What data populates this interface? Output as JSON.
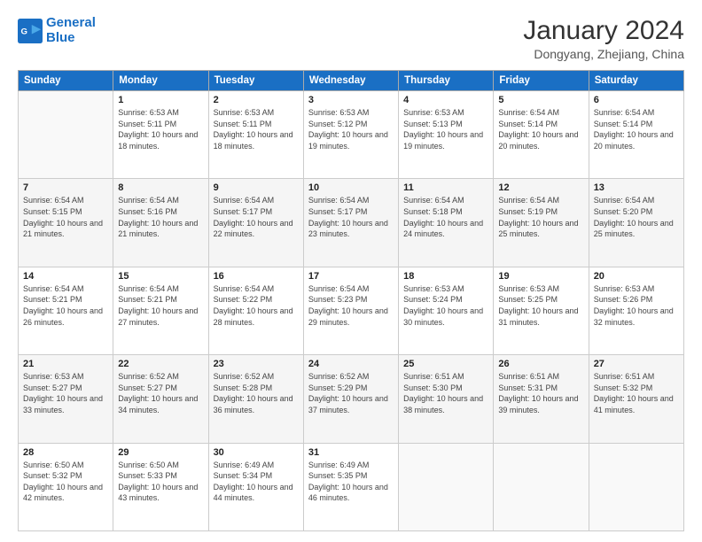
{
  "header": {
    "logo_line1": "General",
    "logo_line2": "Blue",
    "month_year": "January 2024",
    "location": "Dongyang, Zhejiang, China"
  },
  "days_of_week": [
    "Sunday",
    "Monday",
    "Tuesday",
    "Wednesday",
    "Thursday",
    "Friday",
    "Saturday"
  ],
  "weeks": [
    [
      {
        "day": "",
        "sunrise": "",
        "sunset": "",
        "daylight": ""
      },
      {
        "day": "1",
        "sunrise": "Sunrise: 6:53 AM",
        "sunset": "Sunset: 5:11 PM",
        "daylight": "Daylight: 10 hours and 18 minutes."
      },
      {
        "day": "2",
        "sunrise": "Sunrise: 6:53 AM",
        "sunset": "Sunset: 5:11 PM",
        "daylight": "Daylight: 10 hours and 18 minutes."
      },
      {
        "day": "3",
        "sunrise": "Sunrise: 6:53 AM",
        "sunset": "Sunset: 5:12 PM",
        "daylight": "Daylight: 10 hours and 19 minutes."
      },
      {
        "day": "4",
        "sunrise": "Sunrise: 6:53 AM",
        "sunset": "Sunset: 5:13 PM",
        "daylight": "Daylight: 10 hours and 19 minutes."
      },
      {
        "day": "5",
        "sunrise": "Sunrise: 6:54 AM",
        "sunset": "Sunset: 5:14 PM",
        "daylight": "Daylight: 10 hours and 20 minutes."
      },
      {
        "day": "6",
        "sunrise": "Sunrise: 6:54 AM",
        "sunset": "Sunset: 5:14 PM",
        "daylight": "Daylight: 10 hours and 20 minutes."
      }
    ],
    [
      {
        "day": "7",
        "sunrise": "Sunrise: 6:54 AM",
        "sunset": "Sunset: 5:15 PM",
        "daylight": "Daylight: 10 hours and 21 minutes."
      },
      {
        "day": "8",
        "sunrise": "Sunrise: 6:54 AM",
        "sunset": "Sunset: 5:16 PM",
        "daylight": "Daylight: 10 hours and 21 minutes."
      },
      {
        "day": "9",
        "sunrise": "Sunrise: 6:54 AM",
        "sunset": "Sunset: 5:17 PM",
        "daylight": "Daylight: 10 hours and 22 minutes."
      },
      {
        "day": "10",
        "sunrise": "Sunrise: 6:54 AM",
        "sunset": "Sunset: 5:17 PM",
        "daylight": "Daylight: 10 hours and 23 minutes."
      },
      {
        "day": "11",
        "sunrise": "Sunrise: 6:54 AM",
        "sunset": "Sunset: 5:18 PM",
        "daylight": "Daylight: 10 hours and 24 minutes."
      },
      {
        "day": "12",
        "sunrise": "Sunrise: 6:54 AM",
        "sunset": "Sunset: 5:19 PM",
        "daylight": "Daylight: 10 hours and 25 minutes."
      },
      {
        "day": "13",
        "sunrise": "Sunrise: 6:54 AM",
        "sunset": "Sunset: 5:20 PM",
        "daylight": "Daylight: 10 hours and 25 minutes."
      }
    ],
    [
      {
        "day": "14",
        "sunrise": "Sunrise: 6:54 AM",
        "sunset": "Sunset: 5:21 PM",
        "daylight": "Daylight: 10 hours and 26 minutes."
      },
      {
        "day": "15",
        "sunrise": "Sunrise: 6:54 AM",
        "sunset": "Sunset: 5:21 PM",
        "daylight": "Daylight: 10 hours and 27 minutes."
      },
      {
        "day": "16",
        "sunrise": "Sunrise: 6:54 AM",
        "sunset": "Sunset: 5:22 PM",
        "daylight": "Daylight: 10 hours and 28 minutes."
      },
      {
        "day": "17",
        "sunrise": "Sunrise: 6:54 AM",
        "sunset": "Sunset: 5:23 PM",
        "daylight": "Daylight: 10 hours and 29 minutes."
      },
      {
        "day": "18",
        "sunrise": "Sunrise: 6:53 AM",
        "sunset": "Sunset: 5:24 PM",
        "daylight": "Daylight: 10 hours and 30 minutes."
      },
      {
        "day": "19",
        "sunrise": "Sunrise: 6:53 AM",
        "sunset": "Sunset: 5:25 PM",
        "daylight": "Daylight: 10 hours and 31 minutes."
      },
      {
        "day": "20",
        "sunrise": "Sunrise: 6:53 AM",
        "sunset": "Sunset: 5:26 PM",
        "daylight": "Daylight: 10 hours and 32 minutes."
      }
    ],
    [
      {
        "day": "21",
        "sunrise": "Sunrise: 6:53 AM",
        "sunset": "Sunset: 5:27 PM",
        "daylight": "Daylight: 10 hours and 33 minutes."
      },
      {
        "day": "22",
        "sunrise": "Sunrise: 6:52 AM",
        "sunset": "Sunset: 5:27 PM",
        "daylight": "Daylight: 10 hours and 34 minutes."
      },
      {
        "day": "23",
        "sunrise": "Sunrise: 6:52 AM",
        "sunset": "Sunset: 5:28 PM",
        "daylight": "Daylight: 10 hours and 36 minutes."
      },
      {
        "day": "24",
        "sunrise": "Sunrise: 6:52 AM",
        "sunset": "Sunset: 5:29 PM",
        "daylight": "Daylight: 10 hours and 37 minutes."
      },
      {
        "day": "25",
        "sunrise": "Sunrise: 6:51 AM",
        "sunset": "Sunset: 5:30 PM",
        "daylight": "Daylight: 10 hours and 38 minutes."
      },
      {
        "day": "26",
        "sunrise": "Sunrise: 6:51 AM",
        "sunset": "Sunset: 5:31 PM",
        "daylight": "Daylight: 10 hours and 39 minutes."
      },
      {
        "day": "27",
        "sunrise": "Sunrise: 6:51 AM",
        "sunset": "Sunset: 5:32 PM",
        "daylight": "Daylight: 10 hours and 41 minutes."
      }
    ],
    [
      {
        "day": "28",
        "sunrise": "Sunrise: 6:50 AM",
        "sunset": "Sunset: 5:32 PM",
        "daylight": "Daylight: 10 hours and 42 minutes."
      },
      {
        "day": "29",
        "sunrise": "Sunrise: 6:50 AM",
        "sunset": "Sunset: 5:33 PM",
        "daylight": "Daylight: 10 hours and 43 minutes."
      },
      {
        "day": "30",
        "sunrise": "Sunrise: 6:49 AM",
        "sunset": "Sunset: 5:34 PM",
        "daylight": "Daylight: 10 hours and 44 minutes."
      },
      {
        "day": "31",
        "sunrise": "Sunrise: 6:49 AM",
        "sunset": "Sunset: 5:35 PM",
        "daylight": "Daylight: 10 hours and 46 minutes."
      },
      {
        "day": "",
        "sunrise": "",
        "sunset": "",
        "daylight": ""
      },
      {
        "day": "",
        "sunrise": "",
        "sunset": "",
        "daylight": ""
      },
      {
        "day": "",
        "sunrise": "",
        "sunset": "",
        "daylight": ""
      }
    ]
  ]
}
